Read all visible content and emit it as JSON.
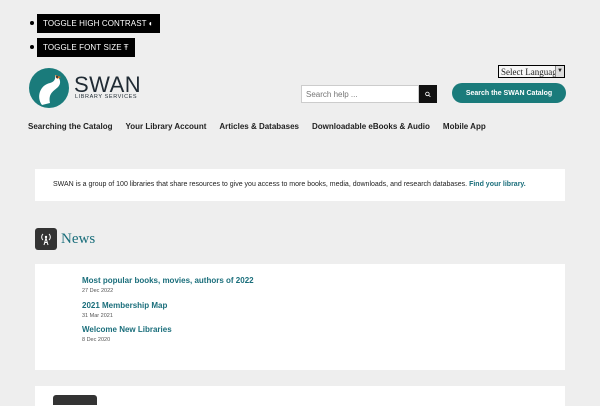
{
  "accessibility": {
    "contrast_label": "Toggle High Contrast",
    "font_label": "Toggle Font Size"
  },
  "language": {
    "selected": "Select Language"
  },
  "logo": {
    "title": "SWAN",
    "subtitle": "LIBRARY SERVICES"
  },
  "search": {
    "placeholder": "Search help ..."
  },
  "catalog_button": "Search the SWAN Catalog",
  "nav": {
    "items": [
      "Searching the Catalog",
      "Your Library Account",
      "Articles & Databases",
      "Downloadable eBooks & Audio",
      "Mobile App"
    ]
  },
  "intro": {
    "text": "SWAN is a group of 100 libraries that share resources to give you access to more books, media, downloads, and research databases. ",
    "link": "Find your library."
  },
  "news": {
    "heading": "News",
    "items": [
      {
        "title": "Most popular books, movies, authors of 2022",
        "date": "27 Dec 2022"
      },
      {
        "title": "2021 Membership Map",
        "date": "31 Mar 2021"
      },
      {
        "title": "Welcome New Libraries",
        "date": "8 Dec 2020"
      }
    ]
  },
  "colors": {
    "accent": "#1a7b7b",
    "link": "#1a6e7b",
    "background": "#eeeeee"
  }
}
